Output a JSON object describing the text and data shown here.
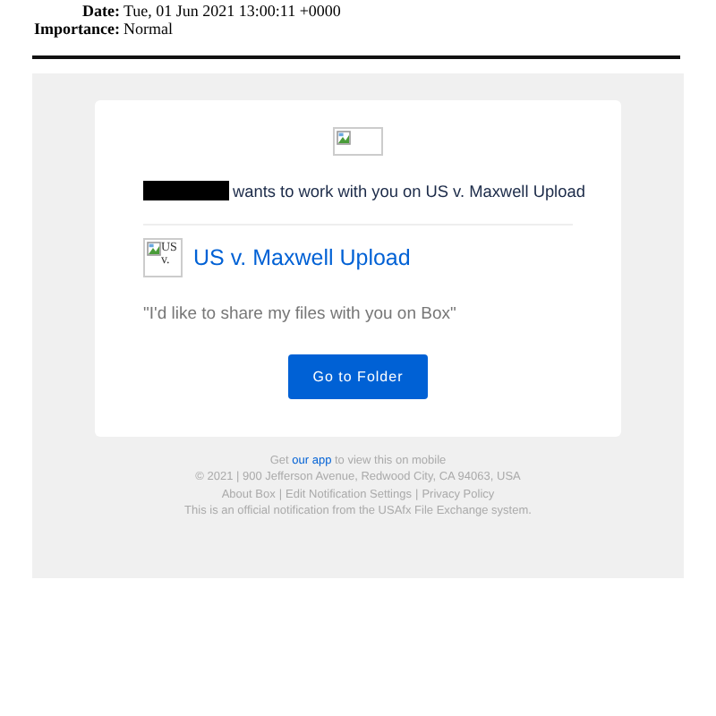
{
  "header_fields": [
    {
      "label": "Date:",
      "value": "Tue, 01 Jun 2021 13:00:11 +0000"
    },
    {
      "label": "Importance:",
      "value": "Normal"
    }
  ],
  "email": {
    "logo": {
      "kind": "broken_image"
    },
    "invite": {
      "redacted": true,
      "text": "wants to work with you on US v. Maxwell Upload"
    },
    "folder": {
      "thumbnail_alt": "US v.",
      "name": "US v. Maxwell Upload"
    },
    "message": "\"I'd like to share my files with you on Box\"",
    "button": "Go to Folder"
  },
  "footer": {
    "app_line": {
      "before": "Get",
      "link": "our app",
      "after": "to view this on mobile"
    },
    "address": "© 2021 | 900 Jefferson Avenue, Redwood City, CA 94063, USA",
    "links": [
      "About Box",
      "Edit Notification Settings",
      "Privacy Policy"
    ],
    "separator": "|",
    "notice": "This is an official notification from the USAfx File Exchange system."
  }
}
